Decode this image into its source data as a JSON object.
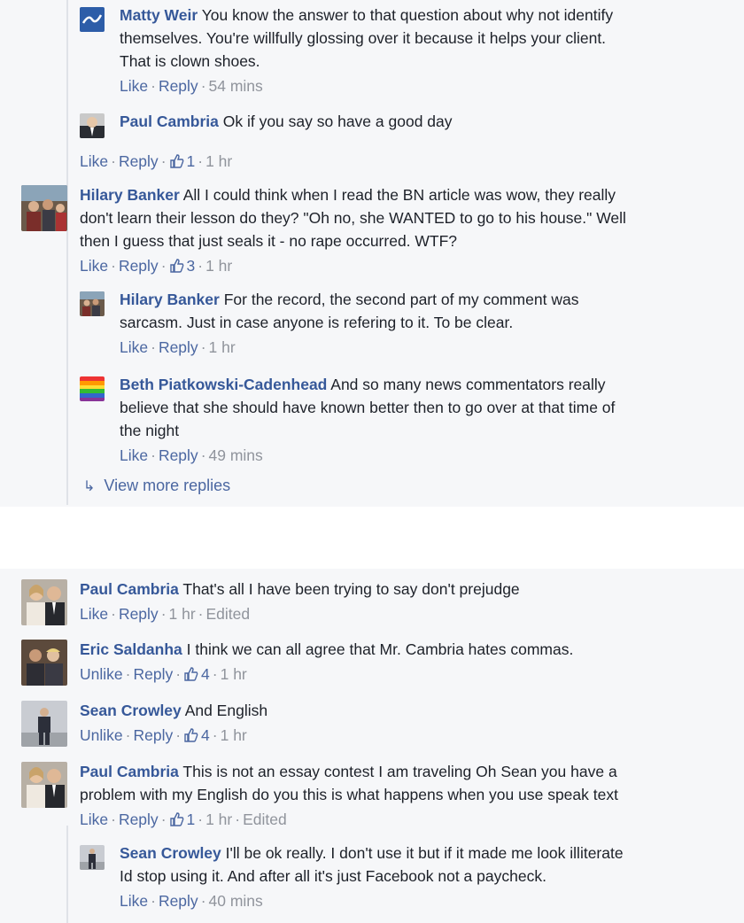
{
  "comments": [
    {
      "id": "c1",
      "author": "Matty Weir",
      "avatar": "logo-avatar",
      "reply": true,
      "lines": [
        "You know the answer to that question about why not identify",
        "themselves. You're willfully glossing over it because it helps your client.",
        "That is clown shoes."
      ],
      "actions": {
        "like": "Like",
        "reply": "Reply",
        "likes": "",
        "time": "54 mins",
        "edited": ""
      }
    },
    {
      "id": "c2",
      "author": "Paul Cambria",
      "avatar": "man-suit-avatar",
      "reply": true,
      "lines": [
        "Ok if you say so have a good day"
      ],
      "actions": {
        "like": "Like",
        "reply": "Reply",
        "likes": "1",
        "time": "1 hr",
        "edited": ""
      }
    },
    {
      "id": "c3",
      "author": "Hilary Banker",
      "avatar": "group-photo-avatar",
      "reply": false,
      "lines": [
        "All I could think when I read the BN article was wow, they really",
        "don't learn their lesson do they? \"Oh no, she WANTED to go to his house.\" Well",
        "then I guess that just seals it - no rape occurred. WTF?"
      ],
      "actions": {
        "like": "Like",
        "reply": "Reply",
        "likes": "3",
        "time": "1 hr",
        "edited": ""
      }
    },
    {
      "id": "c4",
      "author": "Hilary Banker",
      "avatar": "group-photo-avatar",
      "reply": true,
      "lines": [
        "For the record, the second part of my comment was",
        "sarcasm. Just in case anyone is refering to it. To be clear."
      ],
      "actions": {
        "like": "Like",
        "reply": "Reply",
        "likes": "",
        "time": "1 hr",
        "edited": ""
      }
    },
    {
      "id": "c5",
      "author": "Beth Piatkowski-Cadenhead",
      "avatar": "rainbow-avatar",
      "reply": true,
      "lines": [
        "And so many news commentators really",
        "believe that she should have known better then to go over at that time of",
        "the night"
      ],
      "actions": {
        "like": "Like",
        "reply": "Reply",
        "likes": "",
        "time": "49 mins",
        "edited": ""
      }
    },
    {
      "id": "c6",
      "author": "Paul Cambria",
      "avatar": "couple-avatar",
      "reply": false,
      "lines": [
        "That's all I have been trying to say don't prejudge"
      ],
      "actions": {
        "like": "Like",
        "reply": "Reply",
        "likes": "",
        "time": "1 hr",
        "edited": "Edited"
      }
    },
    {
      "id": "c7",
      "author": "Eric Saldanha",
      "avatar": "two-men-avatar",
      "reply": false,
      "lines": [
        "I think we can all agree that Mr. Cambria hates commas."
      ],
      "actions": {
        "like": "Unlike",
        "reply": "Reply",
        "likes": "4",
        "time": "1 hr",
        "edited": ""
      }
    },
    {
      "id": "c8",
      "author": "Sean Crowley",
      "avatar": "standing-man-avatar",
      "reply": false,
      "lines": [
        "And English"
      ],
      "actions": {
        "like": "Unlike",
        "reply": "Reply",
        "likes": "4",
        "time": "1 hr",
        "edited": ""
      }
    },
    {
      "id": "c9",
      "author": "Paul Cambria",
      "avatar": "couple-avatar",
      "reply": false,
      "lines": [
        "This is not an essay contest I am traveling Oh Sean you have a",
        "problem with my English do you this is what happens when you use speak text"
      ],
      "actions": {
        "like": "Like",
        "reply": "Reply",
        "likes": "1",
        "time": "1 hr",
        "edited": "Edited"
      }
    },
    {
      "id": "c10",
      "author": "Sean Crowley",
      "avatar": "standing-man-avatar",
      "reply": true,
      "lines": [
        "I'll be ok really. I don't use it but if it made me look illiterate",
        "Id stop using it. And after all it's just Facebook not a paycheck."
      ],
      "actions": {
        "like": "Like",
        "reply": "Reply",
        "likes": "",
        "time": "40 mins",
        "edited": ""
      }
    }
  ],
  "view_more": {
    "icon": "reply-arrow-icon",
    "label": "View more replies"
  },
  "colors": {
    "author": "#365899",
    "link": "#4b67a1",
    "meta": "#90949c",
    "text": "#1d2129",
    "background": "#f6f7f9"
  }
}
